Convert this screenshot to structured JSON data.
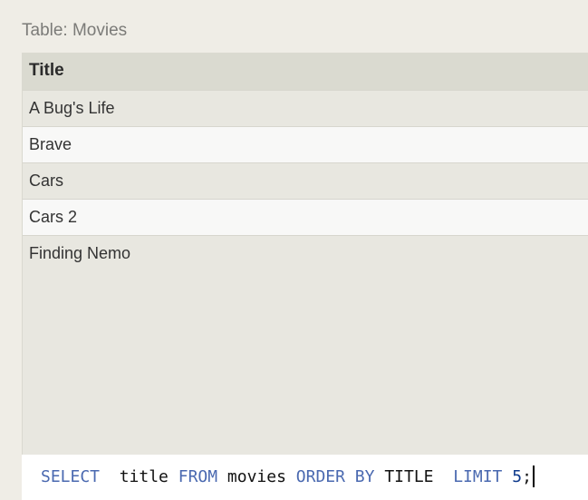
{
  "table_caption": "Table: Movies",
  "results": {
    "columns": [
      "Title"
    ],
    "rows": [
      [
        "A Bug's Life"
      ],
      [
        "Brave"
      ],
      [
        "Cars"
      ],
      [
        "Cars 2"
      ],
      [
        "Finding Nemo"
      ]
    ]
  },
  "query": {
    "tokens": [
      {
        "text": "SELECT",
        "type": "keyword"
      },
      {
        "text": "  title",
        "type": "plain"
      },
      {
        "text": " FROM",
        "type": "keyword"
      },
      {
        "text": " movies",
        "type": "plain"
      },
      {
        "text": " ORDER BY",
        "type": "keyword"
      },
      {
        "text": " TITLE",
        "type": "plain"
      },
      {
        "text": "  LIMIT",
        "type": "keyword"
      },
      {
        "text": " 5",
        "type": "number"
      },
      {
        "text": ";",
        "type": "plain"
      }
    ]
  },
  "colors": {
    "keyword": "#4a69b0",
    "number": "#0e3a8c",
    "header_bg": "#dadad0",
    "row_alt_bg": "#f8f8f7"
  }
}
